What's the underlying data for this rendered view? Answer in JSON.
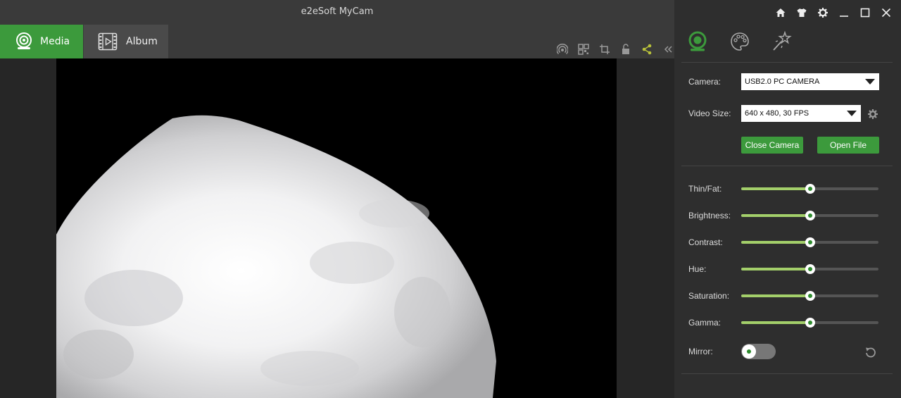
{
  "window": {
    "title": "e2eSoft MyCam"
  },
  "tabs": [
    {
      "label": "Media",
      "icon": "webcam-icon",
      "active": true
    },
    {
      "label": "Album",
      "icon": "film-icon",
      "active": false
    }
  ],
  "toolbar": [
    "broadcast-icon",
    "qr-code-icon",
    "crop-icon",
    "unlock-icon",
    "share-icon",
    "collapse-icon"
  ],
  "window_controls": [
    "home-icon",
    "skin-icon",
    "settings-icon",
    "minimize-icon",
    "maximize-icon",
    "close-icon"
  ],
  "panel_tabs": [
    "camera-icon",
    "palette-icon",
    "effects-icon"
  ],
  "camera": {
    "camera_label": "Camera:",
    "camera_value": "USB2.0 PC CAMERA",
    "video_size_label": "Video Size:",
    "video_size_value": "640 x 480, 30 FPS",
    "close_button": "Close Camera",
    "open_button": "Open File"
  },
  "adjustments": {
    "sliders": [
      {
        "label": "Thin/Fat:",
        "value": 0.5
      },
      {
        "label": "Brightness:",
        "value": 0.5
      },
      {
        "label": "Contrast:",
        "value": 0.5
      },
      {
        "label": "Hue:",
        "value": 0.5
      },
      {
        "label": "Saturation:",
        "value": 0.5
      },
      {
        "label": "Gamma:",
        "value": 0.5
      }
    ],
    "mirror_label": "Mirror:",
    "mirror_on": false
  },
  "colors": {
    "accent": "#3c9a3c",
    "slider_fill": "#a3cf6a",
    "share_icon": "#b9c23a"
  }
}
